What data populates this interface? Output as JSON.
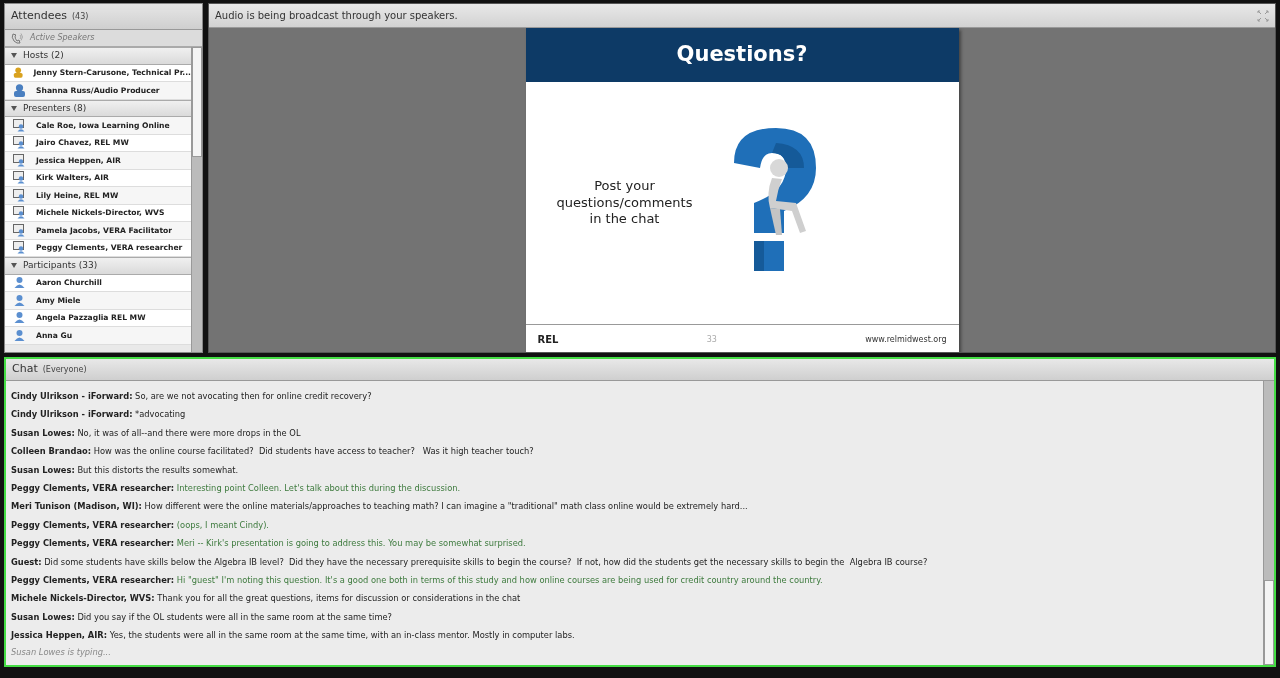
{
  "attendees": {
    "title": "Attendees",
    "count": "(43)",
    "active_speakers": "Active Speakers",
    "groups": [
      {
        "label": "Hosts (2)",
        "expanded": true,
        "kind": "host",
        "people": [
          {
            "name": "Jenny Stern-Carusone, Technical Pr...",
            "color": "#d9a21f"
          },
          {
            "name": "Shanna Russ/Audio Producer",
            "color": "#4a7fc0"
          }
        ]
      },
      {
        "label": "Presenters (8)",
        "expanded": true,
        "kind": "presenter",
        "people": [
          {
            "name": "Cale Roe, Iowa Learning Online"
          },
          {
            "name": "Jairo Chavez, REL MW"
          },
          {
            "name": "Jessica Heppen, AIR"
          },
          {
            "name": "Kirk Walters, AIR"
          },
          {
            "name": "Lily Heine, REL MW"
          },
          {
            "name": "Michele Nickels-Director, WVS"
          },
          {
            "name": "Pamela Jacobs, VERA Facilitator"
          },
          {
            "name": "Peggy Clements, VERA researcher"
          }
        ]
      },
      {
        "label": "Participants (33)",
        "expanded": true,
        "kind": "participant",
        "people": [
          {
            "name": "Aaron Churchill"
          },
          {
            "name": "Amy Miele"
          },
          {
            "name": "Angela Pazzaglia REL MW"
          },
          {
            "name": "Anna Gu"
          }
        ]
      }
    ]
  },
  "share": {
    "status": "Audio is being broadcast through your speakers.",
    "slide": {
      "title": "Questions?",
      "text": "Post your questions/comments in the chat",
      "logo": "REL",
      "page": "33",
      "url": "www.relmidwest.org"
    }
  },
  "chat": {
    "title": "Chat",
    "audience": "(Everyone)",
    "messages": [
      {
        "sender": "Cindy Ulrikson - iForward:",
        "text": "So, are we not avocating then for online credit recovery?",
        "kind": "attendee"
      },
      {
        "sender": "Cindy Ulrikson - iForward:",
        "text": "*advocating",
        "kind": "attendee"
      },
      {
        "sender": "Susan Lowes:",
        "text": "No, it was of all--and there were more drops in the OL",
        "kind": "attendee"
      },
      {
        "sender": "Colleen Brandao:",
        "text": "How was the online course facilitated?  Did students have access to teacher?   Was it high teacher touch?",
        "kind": "attendee"
      },
      {
        "sender": "Susan Lowes:",
        "text": "But this distorts the results somewhat.",
        "kind": "attendee"
      },
      {
        "sender": "Peggy Clements, VERA researcher:",
        "text": "Interesting point Colleen. Let's talk about this during the discussion.",
        "kind": "presenter"
      },
      {
        "sender": "Meri Tunison (Madison, WI):",
        "text": "How different were the online materials/approaches to teaching math? I can imagine a \"traditional\" math class online would be extremely hard...",
        "kind": "attendee"
      },
      {
        "sender": "Peggy Clements, VERA researcher:",
        "text": "(oops, I meant Cindy).",
        "kind": "presenter"
      },
      {
        "sender": "Peggy Clements, VERA researcher:",
        "text": "Meri -- Kirk's presentation is going to address this. You may be somewhat surprised.",
        "kind": "presenter"
      },
      {
        "sender": "Guest:",
        "text": "Did some students have skills below the Algebra IB level?  Did they have the necessary prerequisite skills to begin the course?  If not, how did the students get the necessary skills to begin the  Algebra IB course?",
        "kind": "attendee"
      },
      {
        "sender": "Peggy Clements, VERA researcher:",
        "text": "Hi \"guest\" I'm noting this question. It's a good one both in terms of this study and how online courses are being used for credit country around the country.",
        "kind": "presenter"
      },
      {
        "sender": "Michele Nickels-Director, WVS:",
        "text": "Thank you for all the great questions, items for discussion or considerations in the chat",
        "kind": "attendee"
      },
      {
        "sender": "Susan Lowes:",
        "text": "Did you say if the OL students were all in the same room at the same time?",
        "kind": "attendee"
      },
      {
        "sender": "Jessica Heppen, AIR:",
        "text": "Yes, the students were all in the same room at the same time, with an in-class mentor. Mostly in computer labs.",
        "kind": "attendee"
      }
    ],
    "typing": "Susan Lowes is typing..."
  }
}
